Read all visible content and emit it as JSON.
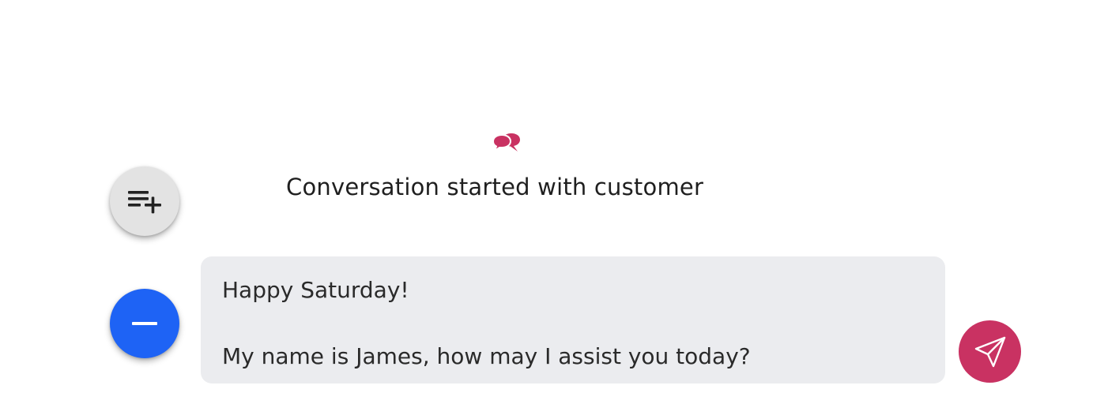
{
  "header": {
    "icon": "chat-bubbles-icon",
    "title": "Conversation started with customer"
  },
  "actions": {
    "add_list_icon": "playlist-add-icon",
    "minimize_icon": "minus-icon",
    "send_icon": "send-icon"
  },
  "message": {
    "line1": "Happy Saturday!",
    "line2": "My name is James, how may I assist you today?"
  },
  "colors": {
    "accent": "#c93262",
    "primary": "#1e63f5",
    "fab_grey": "#e3e3e3",
    "message_bg": "#ebecef"
  }
}
